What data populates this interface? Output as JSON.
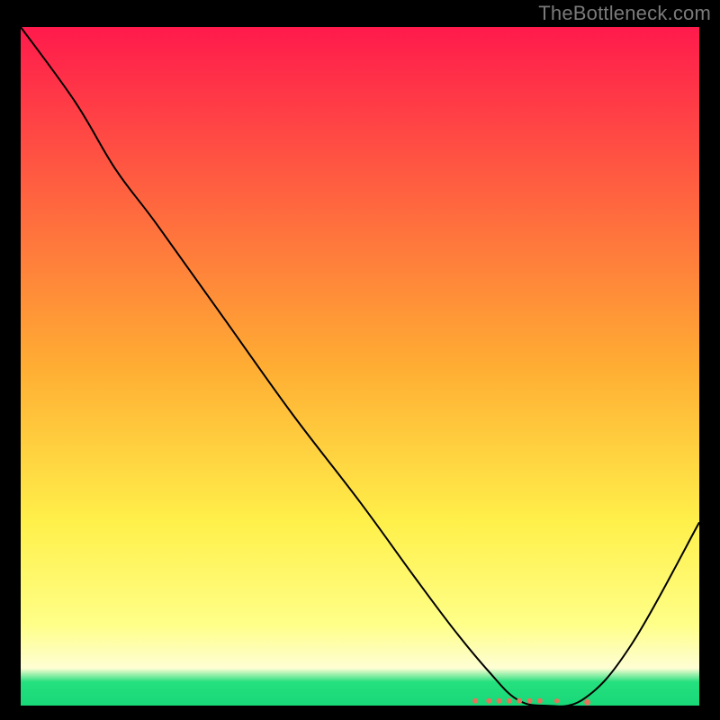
{
  "watermark": "TheBottleneck.com",
  "chart_data": {
    "type": "line",
    "title": "",
    "xlabel": "",
    "ylabel": "",
    "xlim": [
      0,
      100
    ],
    "ylim": [
      0,
      100
    ],
    "grid": false,
    "legend": false,
    "background_gradient": {
      "stops": [
        {
          "offset": 0.0,
          "color": "#ff1a4c"
        },
        {
          "offset": 0.5,
          "color": "#ffad33"
        },
        {
          "offset": 0.73,
          "color": "#fff04a"
        },
        {
          "offset": 0.88,
          "color": "#ffff88"
        },
        {
          "offset": 0.945,
          "color": "#fefed4"
        },
        {
          "offset": 0.965,
          "color": "#25e07e"
        },
        {
          "offset": 1.0,
          "color": "#18d878"
        }
      ]
    },
    "series": [
      {
        "name": "bottleneck-curve",
        "x": [
          0,
          8,
          14,
          20,
          30,
          40,
          50,
          58,
          64,
          69,
          73,
          77,
          83,
          90,
          100
        ],
        "y": [
          100,
          89,
          79,
          71,
          57,
          43,
          30,
          19,
          11,
          5,
          1,
          0,
          1,
          9,
          27
        ],
        "color": "#000000",
        "linewidth": 2
      }
    ],
    "markers": {
      "name": "optimal-range-markers",
      "color": "#e8735c",
      "points": [
        {
          "x": 67,
          "y": 0.7,
          "r": 3.0
        },
        {
          "x": 69,
          "y": 0.7,
          "r": 3.0
        },
        {
          "x": 70.5,
          "y": 0.7,
          "r": 3.0
        },
        {
          "x": 72,
          "y": 0.7,
          "r": 3.0
        },
        {
          "x": 73.5,
          "y": 0.7,
          "r": 3.0
        },
        {
          "x": 75,
          "y": 0.7,
          "r": 3.0
        },
        {
          "x": 76.5,
          "y": 0.7,
          "r": 3.0
        },
        {
          "x": 79,
          "y": 0.7,
          "r": 2.7
        },
        {
          "x": 83.5,
          "y": 0.5,
          "r": 3.4
        }
      ]
    }
  }
}
